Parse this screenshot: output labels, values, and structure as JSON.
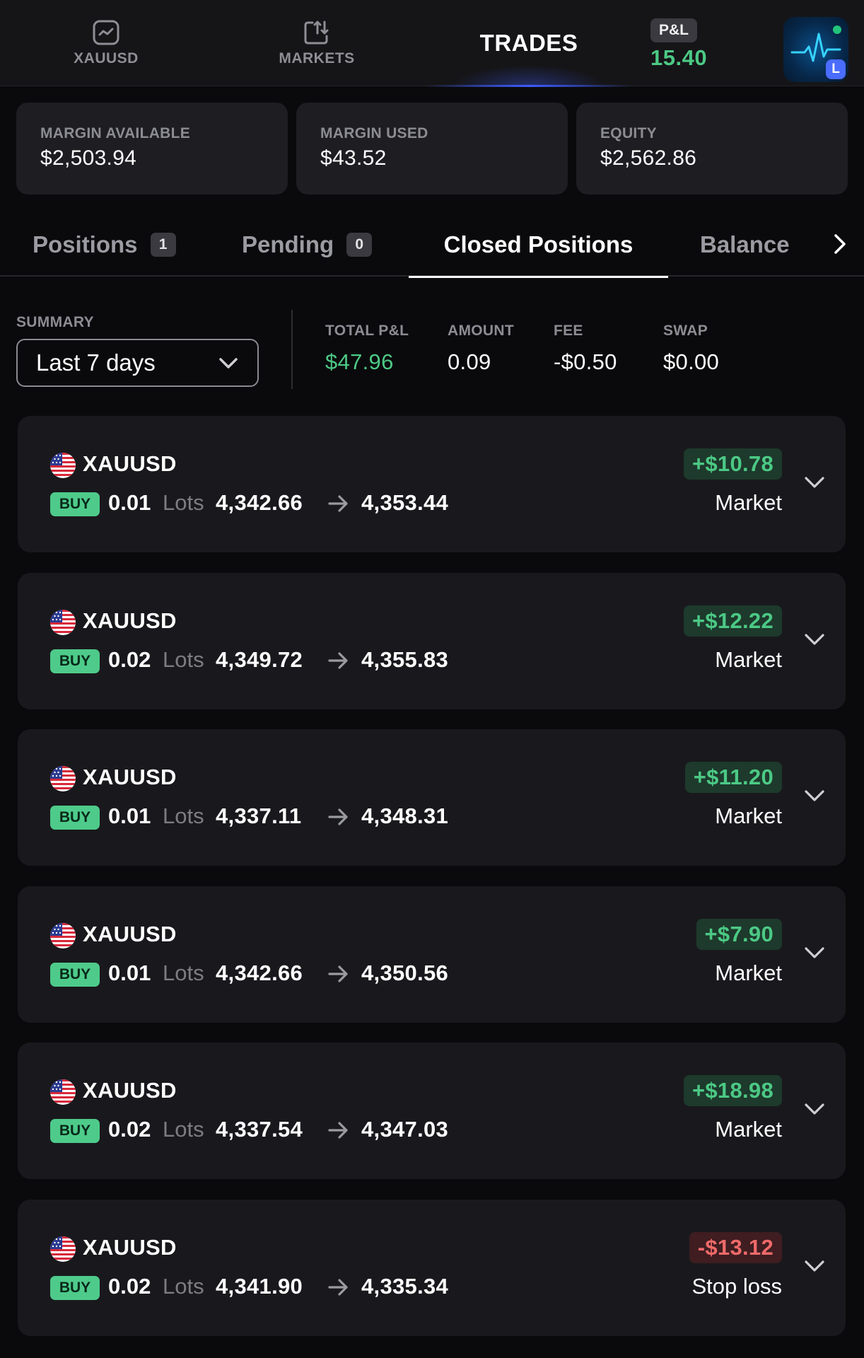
{
  "nav": {
    "xauusd_label": "XAUUSD",
    "markets_label": "MARKETS",
    "trades_label": "TRADES",
    "pnl_badge": "P&L",
    "pnl_value": "15.40",
    "avatar_tag": "L"
  },
  "account": {
    "margin_available": {
      "label": "MARGIN AVAILABLE",
      "value": "$2,503.94"
    },
    "margin_used": {
      "label": "MARGIN USED",
      "value": "$43.52"
    },
    "equity": {
      "label": "EQUITY",
      "value": "$2,562.86"
    }
  },
  "tabs": {
    "positions": {
      "label": "Positions",
      "count": "1"
    },
    "pending": {
      "label": "Pending",
      "count": "0"
    },
    "closed": {
      "label": "Closed Positions"
    },
    "balance": {
      "label": "Balance"
    }
  },
  "summary": {
    "label": "SUMMARY",
    "period": "Last 7 days",
    "total_pnl": {
      "label": "TOTAL P&L",
      "value": "$47.96"
    },
    "amount": {
      "label": "AMOUNT",
      "value": "0.09"
    },
    "fee": {
      "label": "FEE",
      "value": "-$0.50"
    },
    "swap": {
      "label": "SWAP",
      "value": "$0.00"
    }
  },
  "trades": [
    {
      "symbol": "XAUUSD",
      "side": "BUY",
      "lots": "0.01",
      "lots_label": "Lots",
      "open": "4,342.66",
      "close": "4,353.44",
      "pnl": "+$10.78",
      "reason": "Market"
    },
    {
      "symbol": "XAUUSD",
      "side": "BUY",
      "lots": "0.02",
      "lots_label": "Lots",
      "open": "4,349.72",
      "close": "4,355.83",
      "pnl": "+$12.22",
      "reason": "Market"
    },
    {
      "symbol": "XAUUSD",
      "side": "BUY",
      "lots": "0.01",
      "lots_label": "Lots",
      "open": "4,337.11",
      "close": "4,348.31",
      "pnl": "+$11.20",
      "reason": "Market"
    },
    {
      "symbol": "XAUUSD",
      "side": "BUY",
      "lots": "0.01",
      "lots_label": "Lots",
      "open": "4,342.66",
      "close": "4,350.56",
      "pnl": "+$7.90",
      "reason": "Market"
    },
    {
      "symbol": "XAUUSD",
      "side": "BUY",
      "lots": "0.02",
      "lots_label": "Lots",
      "open": "4,337.54",
      "close": "4,347.03",
      "pnl": "+$18.98",
      "reason": "Market"
    },
    {
      "symbol": "XAUUSD",
      "side": "BUY",
      "lots": "0.02",
      "lots_label": "Lots",
      "open": "4,341.90",
      "close": "4,335.34",
      "pnl": "-$13.12",
      "reason": "Stop loss"
    }
  ],
  "colors": {
    "positive": "#4cc985",
    "negative": "#f06a6a",
    "buy_badge": "#4ecb8a",
    "accent": "#3d5bff"
  },
  "icons": {
    "nav_xauusd": "chart-icon",
    "nav_markets": "swap-arrows-icon",
    "tab_next": "chevron-right-icon",
    "select": "chevron-down-icon",
    "flag": "us-flag-icon",
    "price_arrow": "arrow-right-icon",
    "expand": "chevron-down-icon"
  }
}
